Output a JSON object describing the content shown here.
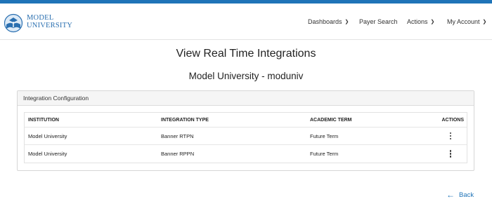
{
  "colors": {
    "accent": "#1f74b8",
    "logo_text": "#2a6fb0"
  },
  "logo": {
    "line1": "MODEL",
    "line2": "UNIVERSITY",
    "icon": "university-logo-icon"
  },
  "nav": {
    "dashboards": "Dashboards",
    "payer_search": "Payer Search",
    "actions": "Actions",
    "my_account": "My Account",
    "chevron_icon": "chevron-down-icon"
  },
  "page": {
    "title": "View Real Time Integrations",
    "subtitle": "Model University - moduniv"
  },
  "card": {
    "title": "Integration Configuration",
    "columns": [
      "INSTITUTION",
      "INTEGRATION TYPE",
      "ACADEMIC TERM",
      "ACTIONS"
    ],
    "rows": [
      {
        "institution": "Model University",
        "integration_type": "Banner RTPN",
        "academic_term": "Future Term",
        "action_icon": "kebab-menu-icon"
      },
      {
        "institution": "Model University",
        "integration_type": "Banner RPPN",
        "academic_term": "Future Term",
        "action_icon": "kebab-menu-icon"
      }
    ]
  },
  "footer": {
    "back_label": "Back",
    "back_icon": "arrow-left-icon"
  }
}
